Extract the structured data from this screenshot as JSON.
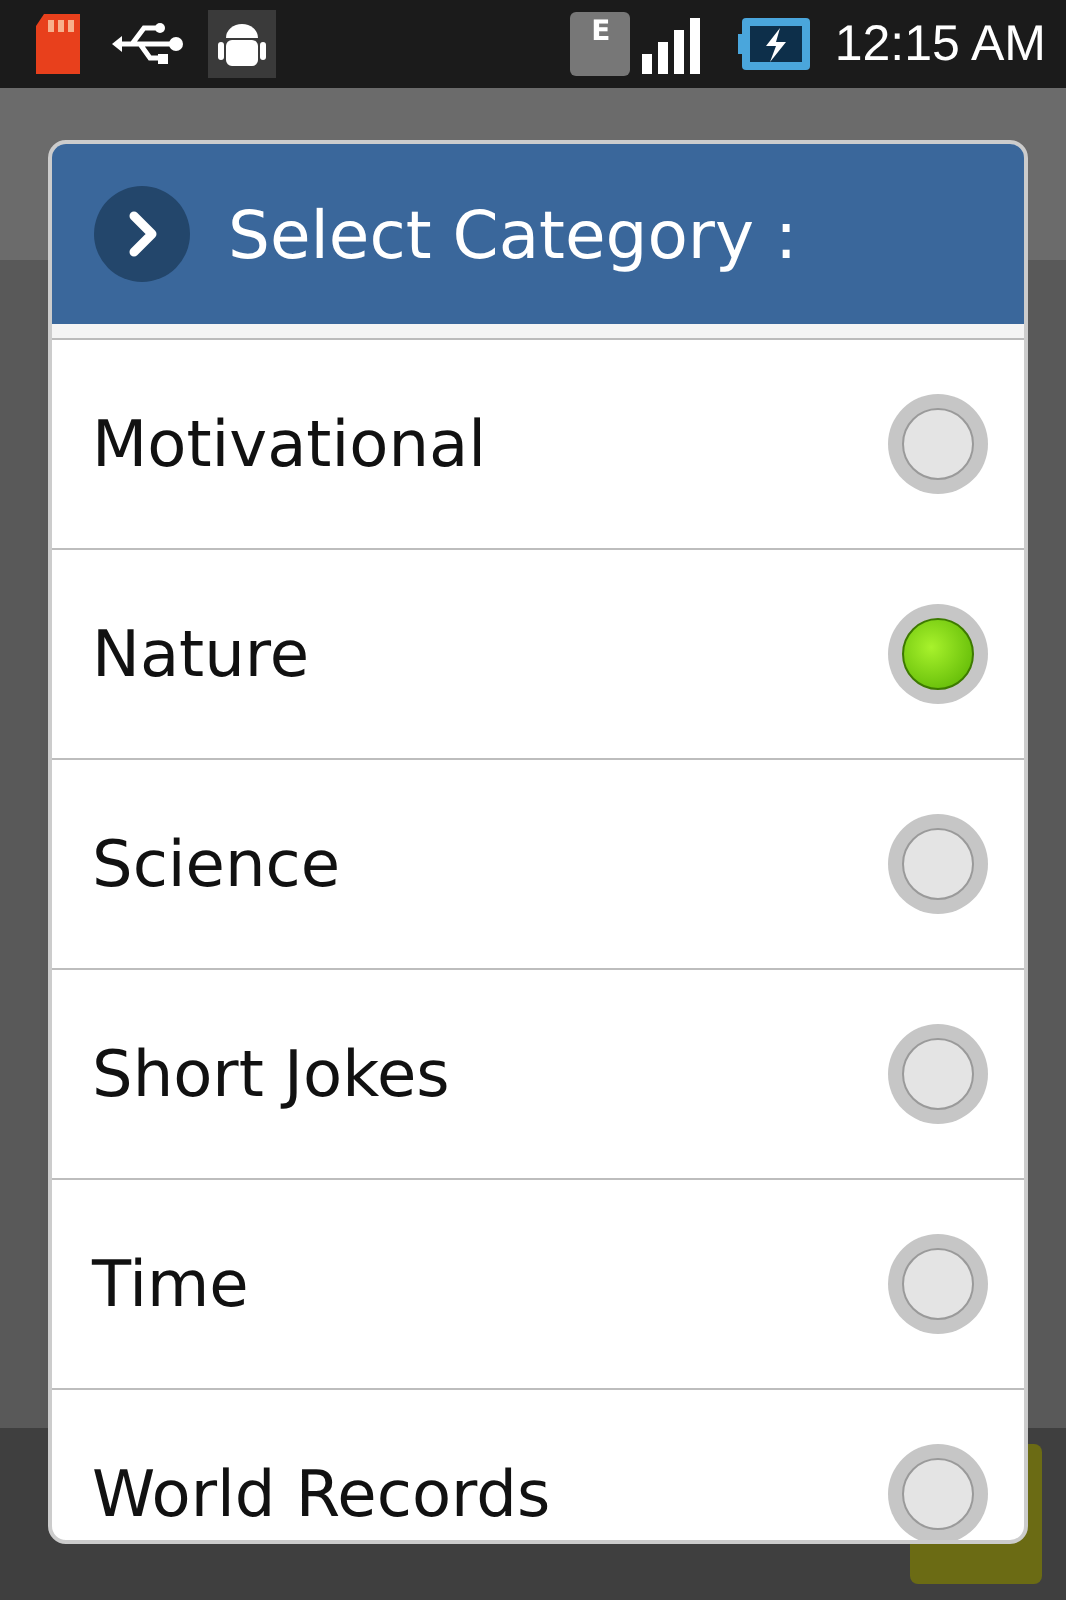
{
  "status_bar": {
    "time": "12:15 AM",
    "network_type": "E"
  },
  "dialog": {
    "title": "Select Category :",
    "options": [
      {
        "label": "Motivational",
        "selected": false
      },
      {
        "label": "Nature",
        "selected": true
      },
      {
        "label": "Science",
        "selected": false
      },
      {
        "label": "Short Jokes",
        "selected": false
      },
      {
        "label": "Time",
        "selected": false
      },
      {
        "label": "World Records",
        "selected": false
      }
    ]
  }
}
